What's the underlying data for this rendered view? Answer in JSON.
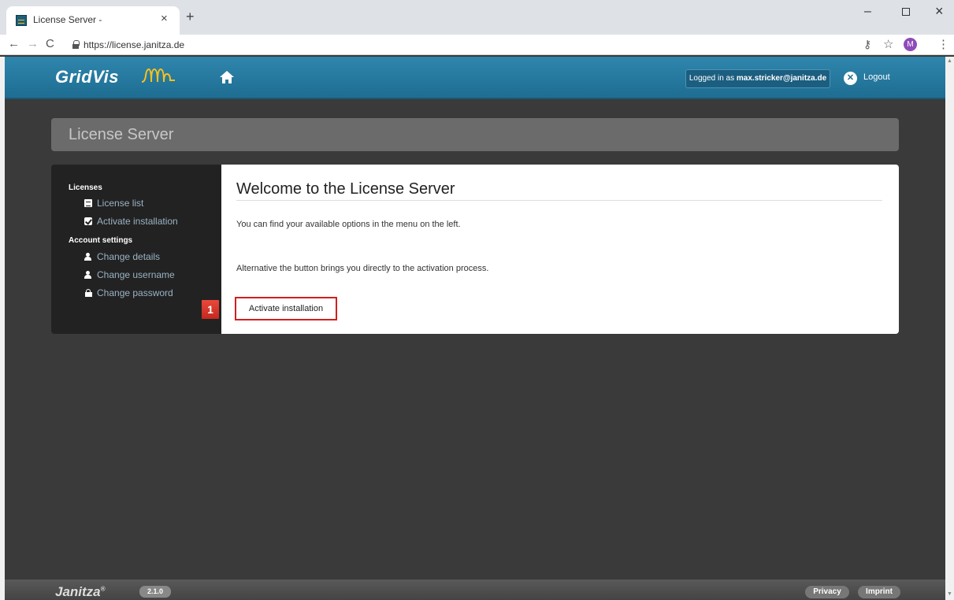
{
  "browser": {
    "tab_title": "License Server -",
    "tab_close": "×",
    "new_tab": "+",
    "url": "https://license.janitza.de",
    "profile_initial": "M",
    "window_min": "–",
    "window_close": "×"
  },
  "header": {
    "logo": "GridVis",
    "logged_in_prefix": "Logged in as ",
    "logged_in_user": "max.stricker@janitza.de",
    "logout_label": "Logout"
  },
  "page": {
    "title": "License Server"
  },
  "sidebar": {
    "section_licenses": "Licenses",
    "license_list": "License list",
    "activate_installation": "Activate installation",
    "section_account": "Account settings",
    "change_details": "Change details",
    "change_username": "Change username",
    "change_password": "Change password"
  },
  "main": {
    "heading": "Welcome to the License Server",
    "text1": "You can find your available options in the menu on the left.",
    "text2": "Alternative the button brings you directly to the activation process.",
    "activate_button": "Activate installation",
    "step_number": "1"
  },
  "footer": {
    "logo": "Janitza",
    "reg": "®",
    "version": "2.1.0",
    "privacy": "Privacy",
    "imprint": "Imprint"
  },
  "colors": {
    "header_blue": "#2f86ad",
    "highlight_red": "#d11f1f",
    "sidebar_link": "#9ab3c4"
  }
}
